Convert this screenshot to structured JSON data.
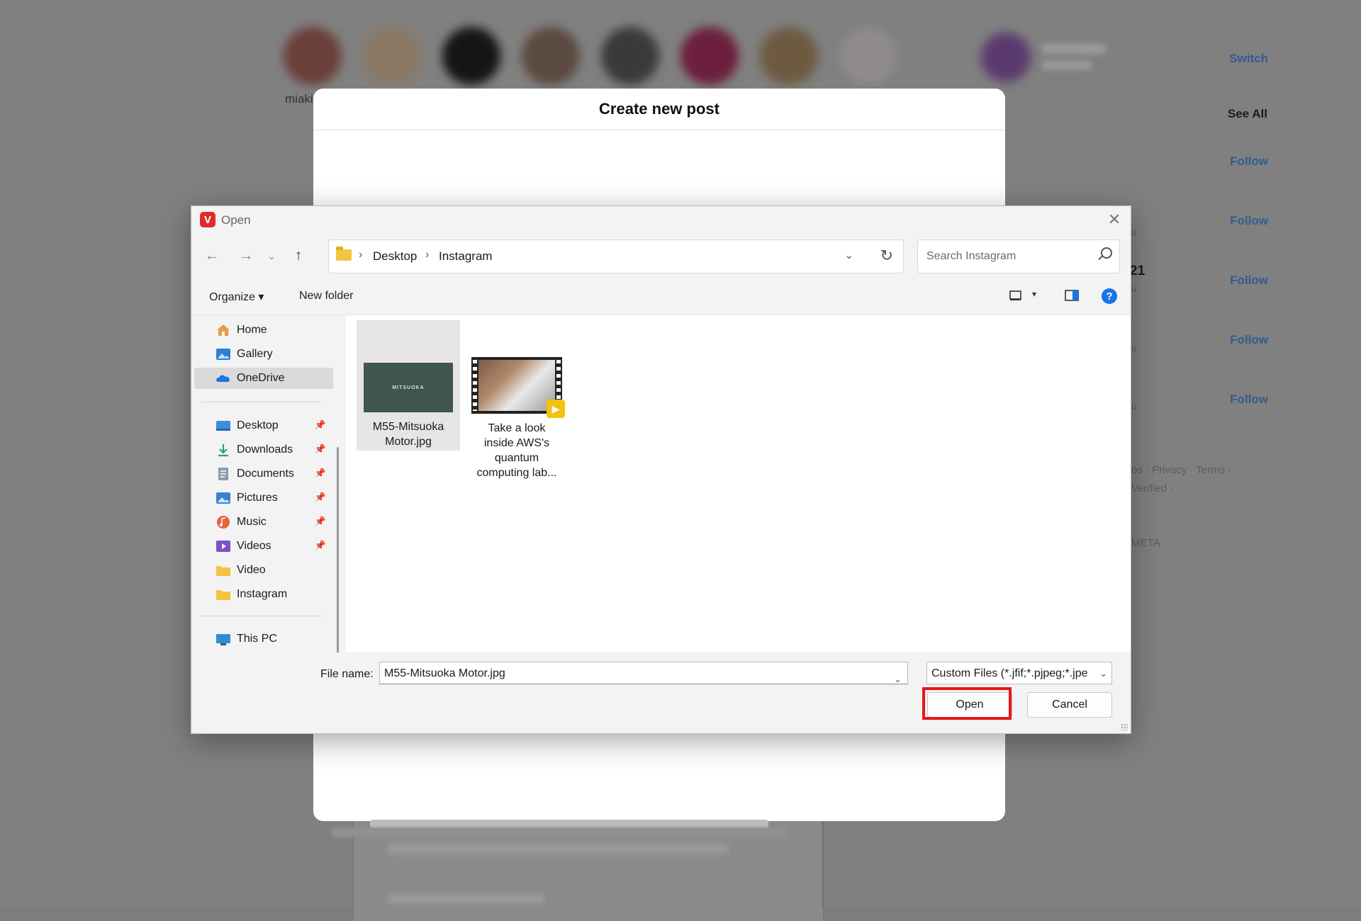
{
  "background": {
    "story_label": "miaki",
    "switch_link": "Switch",
    "see_all": "See All",
    "follow_labels": [
      "Follow",
      "Follow",
      "Follow",
      "Follow",
      "Follow"
    ],
    "partial_texts": [
      "u",
      "21",
      "u",
      "u",
      "u"
    ],
    "footer_line1": "os · Privacy · Terms ·",
    "footer_line2": "Verified ·",
    "footer_line3": "META"
  },
  "modal": {
    "title": "Create new post"
  },
  "dialog": {
    "title": "Open",
    "app_icon_letter": "V",
    "close_glyph": "✕",
    "address": {
      "crumbs": [
        "Desktop",
        "Instagram"
      ]
    },
    "search": {
      "placeholder": "Search Instagram"
    },
    "toolbar": {
      "organize": "Organize ▾",
      "new_folder": "New folder",
      "help": "?"
    },
    "nav_pane": {
      "top_items": [
        {
          "label": "Home",
          "icon": "home-icon",
          "color": "#e07a2e"
        },
        {
          "label": "Gallery",
          "icon": "gallery-icon",
          "color": "#2d7fd3"
        },
        {
          "label": "OneDrive",
          "icon": "onedrive-icon",
          "color": "#1a73e8",
          "selected": true
        }
      ],
      "pinned_items": [
        {
          "label": "Desktop",
          "icon": "desktop-icon",
          "color": "#3b8ed8"
        },
        {
          "label": "Downloads",
          "icon": "downloads-icon",
          "color": "#2aa36b"
        },
        {
          "label": "Documents",
          "icon": "documents-icon",
          "color": "#7a8da8"
        },
        {
          "label": "Pictures",
          "icon": "pictures-icon",
          "color": "#3c7fd0"
        },
        {
          "label": "Music",
          "icon": "music-icon",
          "color": "#e2643d"
        },
        {
          "label": "Videos",
          "icon": "videos-icon",
          "color": "#7d4fc9"
        },
        {
          "label": "Video",
          "icon": "folder-icon",
          "color": "#f2c442"
        },
        {
          "label": "Instagram",
          "icon": "folder-icon",
          "color": "#f2c442"
        }
      ],
      "this_pc": {
        "label": "This PC",
        "icon": "computer-icon",
        "color": "#2b8fd6"
      }
    },
    "files": [
      {
        "name": "M55-Mitsuoka Motor.jpg",
        "caption_lines": [
          "M55-Mitsuoka",
          "Motor.jpg"
        ],
        "thumb_text": "MITSUOKA",
        "selected": true
      },
      {
        "name": "Take a look inside AWS's quantum computing lab...",
        "caption_lines": [
          "Take a look",
          "inside AWS's",
          "quantum",
          "computing lab..."
        ],
        "badge": "Player"
      }
    ],
    "bottom": {
      "file_name_label": "File name:",
      "file_name_value": "M55-Mitsuoka Motor.jpg",
      "file_type": "Custom Files (*.jfif;*.pjpeg;*.jpe",
      "open_label": "Open",
      "cancel_label": "Cancel"
    },
    "highlight_color": "#e8161b"
  }
}
